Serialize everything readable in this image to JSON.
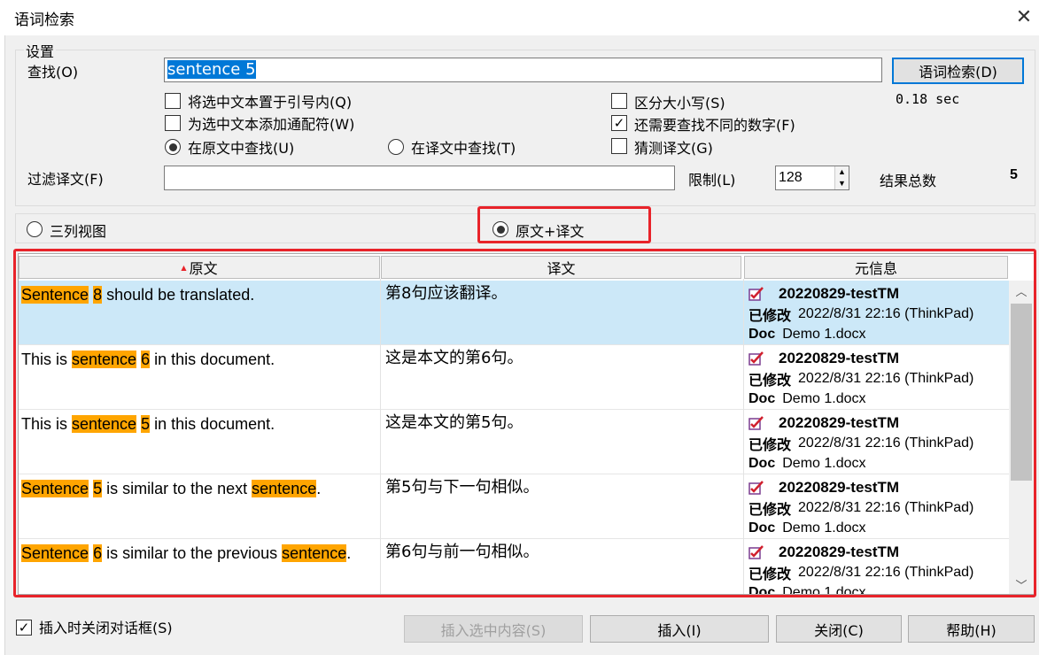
{
  "window": {
    "title": "语词检索",
    "close_glyph": "✕"
  },
  "settings": {
    "legend": "设置",
    "find_label": "查找(O)",
    "find_value": "sentence 5",
    "search_button": "语词检索(D)",
    "elapsed": "0.18 sec",
    "options": [
      {
        "label": "将选中文本置于引号内(Q)",
        "checked": false
      },
      {
        "label": "为选中文本添加通配符(W)",
        "checked": false
      },
      {
        "label": "区分大小写(S)",
        "checked": false
      },
      {
        "label": "还需要查找不同的数字(F)",
        "checked": true
      },
      {
        "label": "猜测译文(G)",
        "checked": false
      }
    ],
    "search_in_source": "在原文中查找(U)",
    "search_in_target": "在译文中查找(T)",
    "filter_label": "过滤译文(F)",
    "filter_value": "",
    "limit_label": "限制(L)",
    "limit_value": "128",
    "total_label": "结果总数",
    "total_value": "5"
  },
  "view": {
    "three_column": "三列视图",
    "source_target": "原文+译文",
    "selected": "source_target"
  },
  "table": {
    "headers": [
      "原文",
      "译文",
      "元信息"
    ],
    "sort_glyph": "▲",
    "rows": [
      {
        "source_parts": [
          [
            "Sentence",
            true
          ],
          [
            " ",
            false
          ],
          [
            "8",
            true
          ],
          [
            " should be translated.",
            false
          ]
        ],
        "target": "第8句应该翻译。",
        "tm": "20220829-testTM",
        "modified_label": "已修改",
        "modified": "2022/8/31 22:16 (ThinkPad)",
        "doc_label": "Doc",
        "doc": "Demo 1.docx",
        "selected": true
      },
      {
        "source_parts": [
          [
            "This is ",
            false
          ],
          [
            "sentence",
            true
          ],
          [
            " ",
            false
          ],
          [
            "6",
            true
          ],
          [
            " in this document.",
            false
          ]
        ],
        "target": "这是本文的第6句。",
        "tm": "20220829-testTM",
        "modified_label": "已修改",
        "modified": "2022/8/31 22:16 (ThinkPad)",
        "doc_label": "Doc",
        "doc": "Demo 1.docx",
        "selected": false
      },
      {
        "source_parts": [
          [
            "This is ",
            false
          ],
          [
            "sentence",
            true
          ],
          [
            " ",
            false
          ],
          [
            "5",
            true
          ],
          [
            " in this document.",
            false
          ]
        ],
        "target": "这是本文的第5句。",
        "tm": "20220829-testTM",
        "modified_label": "已修改",
        "modified": "2022/8/31 22:16 (ThinkPad)",
        "doc_label": "Doc",
        "doc": "Demo 1.docx",
        "selected": false
      },
      {
        "source_parts": [
          [
            "Sentence",
            true
          ],
          [
            " ",
            false
          ],
          [
            "5",
            true
          ],
          [
            " is similar to the next ",
            false
          ],
          [
            "sentence",
            true
          ],
          [
            ".",
            false
          ]
        ],
        "target": "第5句与下一句相似。",
        "tm": "20220829-testTM",
        "modified_label": "已修改",
        "modified": "2022/8/31 22:16 (ThinkPad)",
        "doc_label": "Doc",
        "doc": "Demo 1.docx",
        "selected": false
      },
      {
        "source_parts": [
          [
            "Sentence",
            true
          ],
          [
            " ",
            false
          ],
          [
            "6",
            true
          ],
          [
            " is similar to the previous ",
            false
          ],
          [
            "sentence",
            true
          ],
          [
            ".",
            false
          ]
        ],
        "target": "第6句与前一句相似。",
        "tm": "20220829-testTM",
        "modified_label": "已修改",
        "modified": "2022/8/31 22:16 (ThinkPad)",
        "doc_label": "Doc",
        "doc": "Demo 1.docx",
        "selected": false
      }
    ]
  },
  "footer": {
    "close_on_insert": "插入时关闭对话框(S)",
    "close_on_insert_checked": true,
    "insert_selection": "插入选中内容(S)",
    "insert": "插入(I)",
    "close": "关闭(C)",
    "help": "帮助(H)"
  },
  "colors": {
    "highlight": "#ffa500",
    "selected_row": "#cce8f8",
    "annotation_red": "#e8232a",
    "accent": "#0078d7"
  }
}
